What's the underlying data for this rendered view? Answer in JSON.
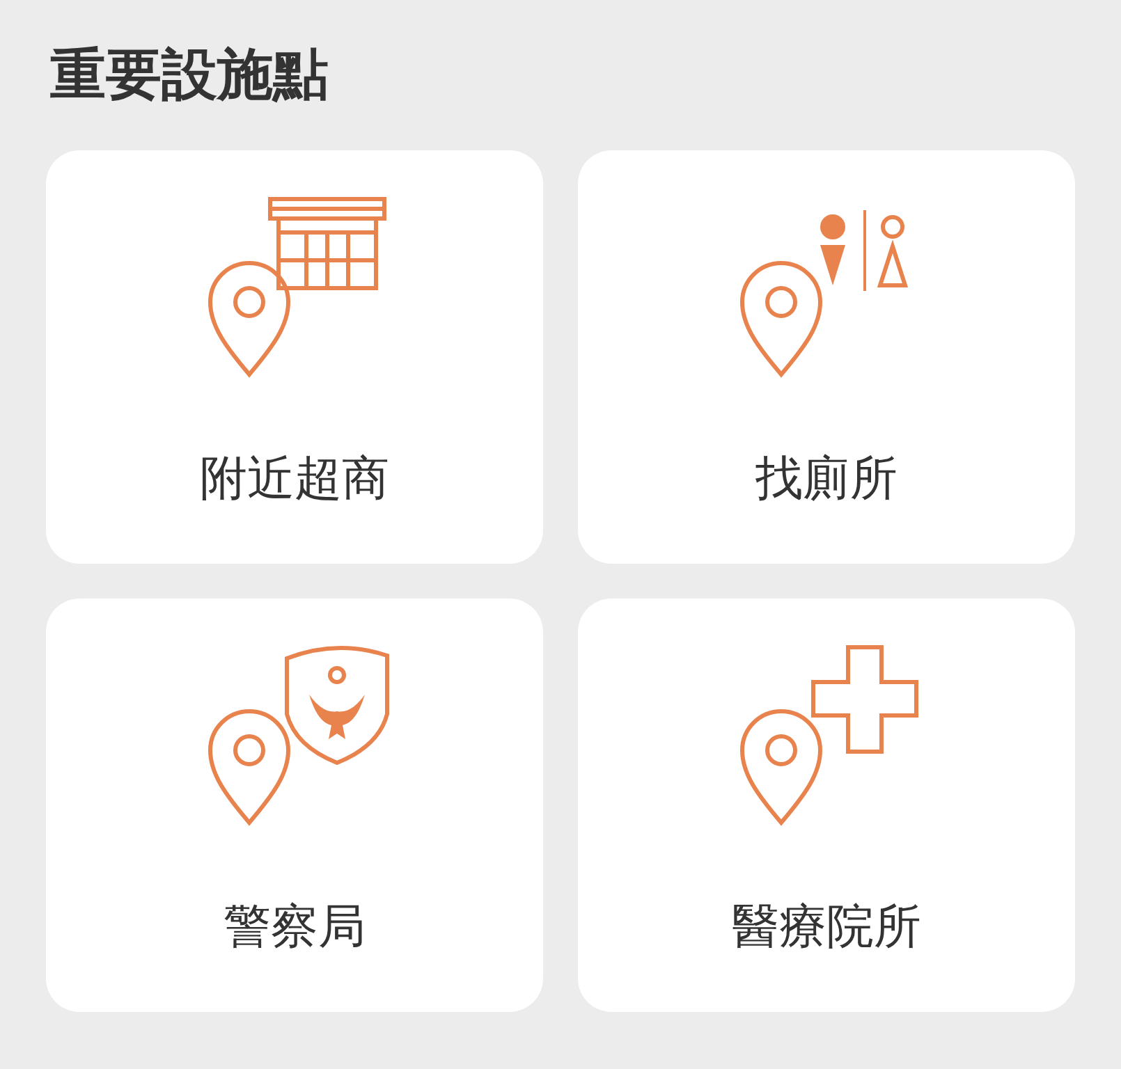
{
  "title": "重要設施點",
  "facilities": [
    {
      "label": "附近超商",
      "kind": "store"
    },
    {
      "label": "找廁所",
      "kind": "toilet"
    },
    {
      "label": "警察局",
      "kind": "police"
    },
    {
      "label": "醫療院所",
      "kind": "medical"
    }
  ]
}
